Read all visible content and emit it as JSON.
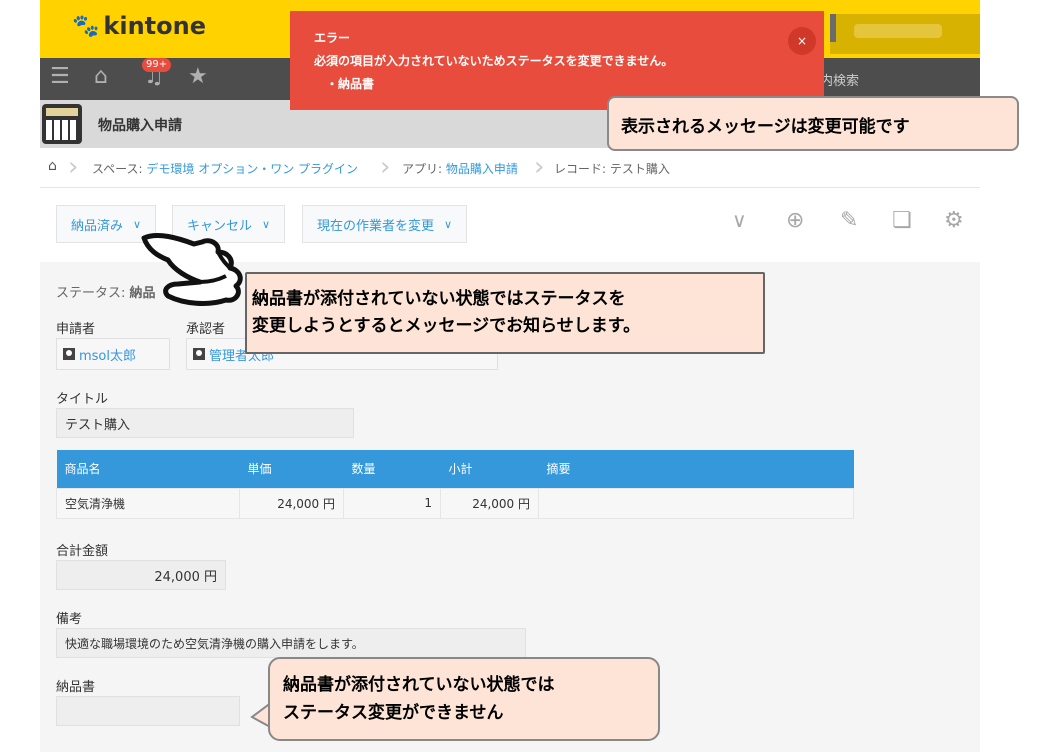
{
  "header": {
    "logo_text": "kintone",
    "notification_badge": "99+",
    "search_link": "内検索"
  },
  "app": {
    "title": "物品購入申請"
  },
  "breadcrumb": {
    "space_prefix": "スペース: ",
    "space_link": "デモ環境 オプション・ワン プラグイン",
    "app_prefix": "アプリ: ",
    "app_link": "物品購入申請",
    "record_label": "レコード: テスト購入"
  },
  "toolbar": {
    "buttons": [
      "納品済み",
      "キャンセル",
      "現在の作業者を変更"
    ]
  },
  "record": {
    "status_label": "ステータス: ",
    "status_value": "納品",
    "applicant_label": "申請者",
    "applicant_value": "msol太郎",
    "approver_label": "承認者",
    "approver_value": "管理者太郎",
    "title_label": "タイトル",
    "title_value": "テスト購入",
    "table": {
      "headers": [
        "商品名",
        "単価",
        "数量",
        "小計",
        "摘要"
      ],
      "rows": [
        [
          "空気清浄機",
          "24,000 円",
          "1",
          "24,000 円",
          ""
        ]
      ]
    },
    "total_label": "合計金額",
    "total_value": "24,000 円",
    "notes_label": "備考",
    "notes_value": "快適な職場環境のため空気清浄機の購入申請をします。",
    "delivery_label": "納品書",
    "delivery_value": ""
  },
  "error": {
    "title": "エラー",
    "message": "必須の項目が入力されていないためステータスを変更できません。",
    "item": "・納品書",
    "close": "×"
  },
  "callouts": {
    "c1": "表示されるメッセージは変更可能です",
    "c2_line1": "納品書が添付されていない状態ではステータスを",
    "c2_line2": "変更しようとするとメッセージでお知らせします。",
    "c3_line1": "納品書が添付されていない状態では",
    "c3_line2": "ステータス変更ができません"
  },
  "colors": {
    "header_yellow": "#ffd200",
    "nav_dark": "#4d4d4d",
    "accent_blue": "#3498db",
    "error_red": "#e74c3c",
    "callout_bg": "#fde4d6"
  }
}
